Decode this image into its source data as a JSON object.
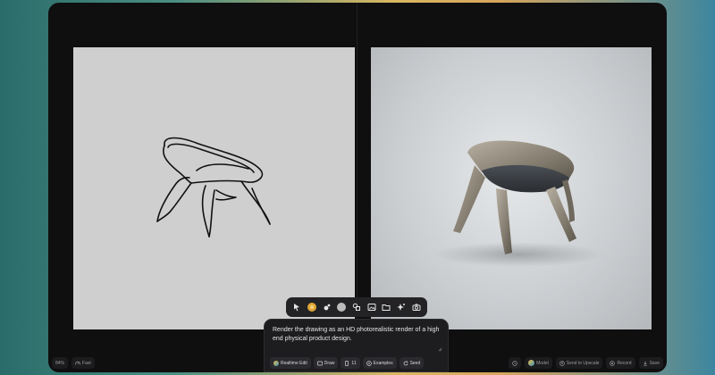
{
  "toolbar": {
    "tools": [
      {
        "name": "select-tool",
        "icon": "cursor-icon"
      },
      {
        "name": "color-tool",
        "icon": "color-swatch-icon",
        "color": "#e0a735"
      },
      {
        "name": "paint-tool",
        "icon": "paint-splash-icon"
      },
      {
        "name": "shape-tool",
        "icon": "circle-shape-icon",
        "color": "#bdbdbd"
      },
      {
        "name": "shapes-tool",
        "icon": "shapes-icon"
      },
      {
        "name": "image-tool",
        "icon": "image-icon"
      },
      {
        "name": "folder-tool",
        "icon": "folder-icon"
      },
      {
        "name": "magic-tool",
        "icon": "sparkle-icon"
      },
      {
        "name": "camera-tool",
        "icon": "camera-icon"
      }
    ]
  },
  "prompt": {
    "text": "Render the drawing as an HD photorealistic render of a high end physical product design."
  },
  "prompt_chips": {
    "realtime_edit": "Realtime Edit",
    "draw": "Draw",
    "steps": "11",
    "examples": "Examples",
    "seed": "Seed"
  },
  "bottom_left": {
    "zoom": "84%",
    "fast": "Fast"
  },
  "bottom_right": {
    "model": "Model",
    "send_to_upscale": "Send to Upscale",
    "record": "Record",
    "save": "Save"
  },
  "colors": {
    "accent": "#e0a735",
    "app_bg": "#0f0f10",
    "canvas_bg": "#cfcfcf"
  }
}
